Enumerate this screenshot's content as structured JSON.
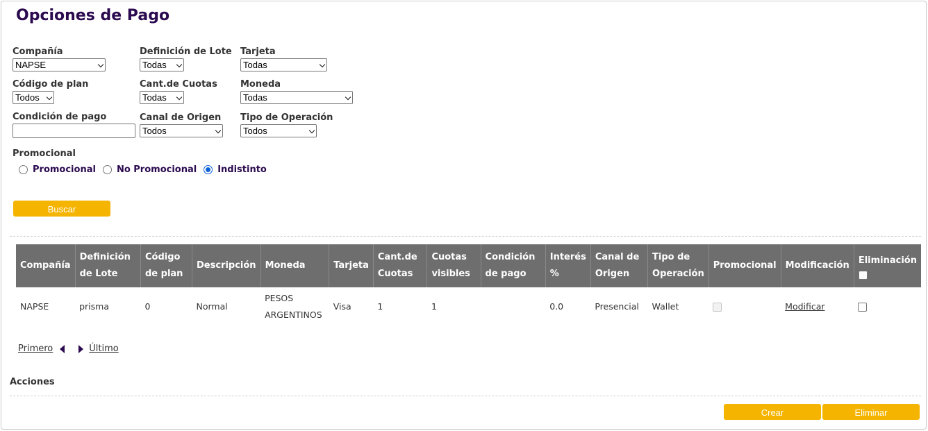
{
  "page": {
    "title": "Opciones de Pago"
  },
  "filters": {
    "compania": {
      "label": "Compañía",
      "value": "NAPSE"
    },
    "definicion_lote": {
      "label": "Definición de Lote",
      "value": "Todas"
    },
    "tarjeta": {
      "label": "Tarjeta",
      "value": "Todas"
    },
    "codigo_plan": {
      "label": "Código de plan",
      "value": "Todos"
    },
    "cant_cuotas": {
      "label": "Cant.de Cuotas",
      "value": "Todas"
    },
    "moneda": {
      "label": "Moneda",
      "value": "Todas"
    },
    "condicion_pago": {
      "label": "Condición de pago",
      "value": ""
    },
    "canal_origen": {
      "label": "Canal de Origen",
      "value": "Todos"
    },
    "tipo_operacion": {
      "label": "Tipo de Operación",
      "value": "Todos"
    }
  },
  "promocional": {
    "label": "Promocional",
    "options": [
      "Promocional",
      "No Promocional",
      "Indistinto"
    ],
    "selected": "Indistinto"
  },
  "buttons": {
    "buscar": "Buscar",
    "crear": "Crear",
    "eliminar": "Eliminar"
  },
  "table": {
    "headers": {
      "compania": "Compañía",
      "definicion_lote": "Definición de Lote",
      "codigo_plan": "Código de plan",
      "descripcion": "Descripción",
      "moneda": "Moneda",
      "tarjeta": "Tarjeta",
      "cant_cuotas": "Cant.de Cuotas",
      "cuotas_visibles": "Cuotas visibles",
      "condicion_pago": "Condición de pago",
      "interes": "Interés %",
      "canal_origen": "Canal de Origen",
      "tipo_operacion": "Tipo de Operación",
      "promocional": "Promocional",
      "modificacion": "Modificación",
      "eliminacion": "Eliminación"
    },
    "rows": [
      {
        "compania": "NAPSE",
        "definicion_lote": "prisma",
        "codigo_plan": "0",
        "descripcion": "Normal",
        "moneda": "PESOS ARGENTINOS",
        "tarjeta": "Visa",
        "cant_cuotas": "1",
        "cuotas_visibles": "1",
        "condicion_pago": "",
        "interes": "0.0",
        "canal_origen": "Presencial",
        "tipo_operacion": "Wallet",
        "promocional_checked": false,
        "modificar_label": "Modificar",
        "eliminar_checked": false
      }
    ]
  },
  "pager": {
    "first": "Primero",
    "last": "Último"
  },
  "acciones": {
    "label": "Acciones"
  }
}
